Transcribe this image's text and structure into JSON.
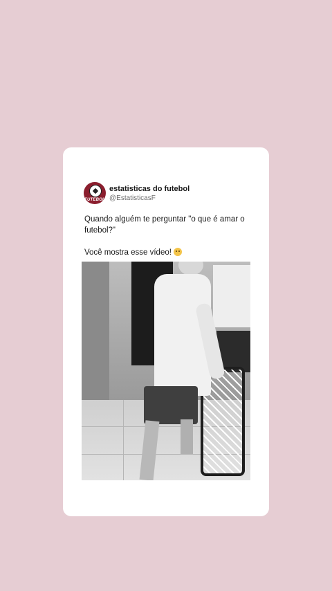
{
  "post": {
    "display_name": "estatisticas do futebol",
    "handle": "@EstatisticasF",
    "avatar_text": "FUTEBOL",
    "text_line1": "Quando alguém te perguntar \"o que é amar o futebol?\"",
    "text_line2": "Você mostra esse vídeo!",
    "text_line2_emoji": "smiling-face-with-tear-icon"
  },
  "colors": {
    "background": "#e6cdd3",
    "card": "#ffffff",
    "avatar": "#8b1e2e"
  },
  "media": {
    "type": "video",
    "style": "grayscale"
  }
}
